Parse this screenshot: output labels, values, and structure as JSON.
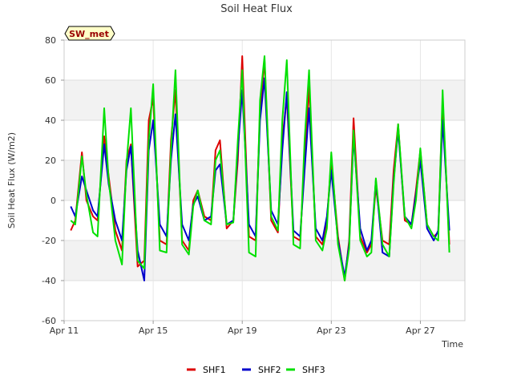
{
  "chart_data": {
    "type": "line",
    "title": "Soil Heat Flux",
    "xlabel": "Time",
    "ylabel": "Soil Heat Flux (W/m2)",
    "site_label": "SW_met",
    "x_domain_days": [
      11,
      29
    ],
    "ylim": [
      -60,
      80
    ],
    "yticks": [
      -60,
      -40,
      -20,
      0,
      20,
      40,
      60,
      80
    ],
    "xticks": [
      {
        "day": 11,
        "label": "Apr 11"
      },
      {
        "day": 15,
        "label": "Apr 15"
      },
      {
        "day": 19,
        "label": "Apr 19"
      },
      {
        "day": 23,
        "label": "Apr 23"
      },
      {
        "day": 27,
        "label": "Apr 27"
      }
    ],
    "grid": true,
    "alternating_bands": true,
    "legend_position": "bottom",
    "series": [
      {
        "name": "SHF1",
        "color": "#dd0000",
        "x": [
          11.3,
          11.5,
          11.8,
          12.0,
          12.3,
          12.5,
          12.8,
          13.0,
          13.3,
          13.6,
          13.8,
          14.0,
          14.3,
          14.6,
          14.8,
          15.0,
          15.3,
          15.6,
          15.8,
          16.0,
          16.3,
          16.6,
          16.8,
          17.0,
          17.3,
          17.6,
          17.8,
          18.0,
          18.3,
          18.6,
          18.8,
          19.0,
          19.3,
          19.6,
          19.8,
          20.0,
          20.3,
          20.6,
          20.8,
          21.0,
          21.3,
          21.6,
          21.8,
          22.0,
          22.3,
          22.6,
          22.8,
          23.0,
          23.3,
          23.6,
          23.8,
          24.0,
          24.3,
          24.6,
          24.8,
          25.0,
          25.3,
          25.6,
          25.8,
          26.0,
          26.3,
          26.6,
          26.8,
          27.0,
          27.3,
          27.6,
          27.8,
          28.0,
          28.3
        ],
        "y": [
          -15,
          -10,
          24,
          0,
          -8,
          -10,
          32,
          12,
          -15,
          -25,
          20,
          28,
          -33,
          -30,
          40,
          51,
          -20,
          -22,
          30,
          55,
          -20,
          -25,
          0,
          5,
          -8,
          -10,
          25,
          30,
          -14,
          -10,
          20,
          72,
          -18,
          -20,
          45,
          70,
          -10,
          -16,
          30,
          52,
          -18,
          -20,
          20,
          57,
          -18,
          -22,
          -10,
          20,
          -18,
          -40,
          -20,
          41,
          -18,
          -26,
          -22,
          7,
          -20,
          -22,
          15,
          38,
          -10,
          -12,
          5,
          25,
          -12,
          -18,
          -16,
          50,
          -22
        ]
      },
      {
        "name": "SHF2",
        "color": "#0000cc",
        "x": [
          11.3,
          11.5,
          11.8,
          12.0,
          12.3,
          12.5,
          12.8,
          13.0,
          13.3,
          13.6,
          13.8,
          14.0,
          14.3,
          14.6,
          14.8,
          15.0,
          15.3,
          15.6,
          15.8,
          16.0,
          16.3,
          16.6,
          16.8,
          17.0,
          17.3,
          17.6,
          17.8,
          18.0,
          18.3,
          18.6,
          18.8,
          19.0,
          19.3,
          19.6,
          19.8,
          20.0,
          20.3,
          20.6,
          20.8,
          21.0,
          21.3,
          21.6,
          21.8,
          22.0,
          22.3,
          22.6,
          22.8,
          23.0,
          23.3,
          23.6,
          23.8,
          24.0,
          24.3,
          24.6,
          24.8,
          25.0,
          25.3,
          25.6,
          25.8,
          26.0,
          26.3,
          26.6,
          26.8,
          27.0,
          27.3,
          27.6,
          27.8,
          28.0,
          28.3
        ],
        "y": [
          -3,
          -8,
          12,
          5,
          -5,
          -8,
          28,
          8,
          -10,
          -20,
          15,
          27,
          -25,
          -40,
          25,
          40,
          -12,
          -18,
          20,
          43,
          -12,
          -20,
          -2,
          2,
          -10,
          -8,
          15,
          18,
          -12,
          -10,
          25,
          55,
          -12,
          -18,
          40,
          61,
          -5,
          -12,
          25,
          54,
          -15,
          -18,
          15,
          46,
          -14,
          -20,
          -8,
          15,
          -20,
          -38,
          -22,
          32,
          -14,
          -25,
          -20,
          10,
          -26,
          -28,
          10,
          35,
          -8,
          -12,
          3,
          20,
          -14,
          -20,
          -15,
          40,
          -15
        ]
      },
      {
        "name": "SHF3",
        "color": "#00e000",
        "x": [
          11.3,
          11.5,
          11.8,
          12.0,
          12.3,
          12.5,
          12.8,
          13.0,
          13.3,
          13.6,
          13.8,
          14.0,
          14.3,
          14.6,
          14.8,
          15.0,
          15.3,
          15.6,
          15.8,
          16.0,
          16.3,
          16.6,
          16.8,
          17.0,
          17.3,
          17.6,
          17.8,
          18.0,
          18.3,
          18.6,
          18.8,
          19.0,
          19.3,
          19.6,
          19.8,
          20.0,
          20.3,
          20.6,
          20.8,
          21.0,
          21.3,
          21.6,
          21.8,
          22.0,
          22.3,
          22.6,
          22.8,
          23.0,
          23.3,
          23.6,
          23.8,
          24.0,
          24.3,
          24.6,
          24.8,
          25.0,
          25.3,
          25.6,
          25.8,
          26.0,
          26.3,
          26.6,
          26.8,
          27.0,
          27.3,
          27.6,
          27.8,
          28.0,
          28.3
        ],
        "y": [
          -10,
          -12,
          22,
          3,
          -16,
          -18,
          46,
          10,
          -20,
          -32,
          18,
          46,
          -30,
          -34,
          30,
          58,
          -25,
          -26,
          25,
          65,
          -22,
          -27,
          -3,
          5,
          -10,
          -12,
          20,
          25,
          -12,
          -11,
          30,
          65,
          -26,
          -28,
          50,
          72,
          -8,
          -15,
          40,
          70,
          -22,
          -24,
          30,
          65,
          -20,
          -25,
          -14,
          24,
          -22,
          -40,
          -24,
          35,
          -20,
          -28,
          -26,
          11,
          -22,
          -28,
          8,
          38,
          -8,
          -14,
          0,
          26,
          -12,
          -18,
          -20,
          55,
          -26
        ]
      }
    ]
  }
}
